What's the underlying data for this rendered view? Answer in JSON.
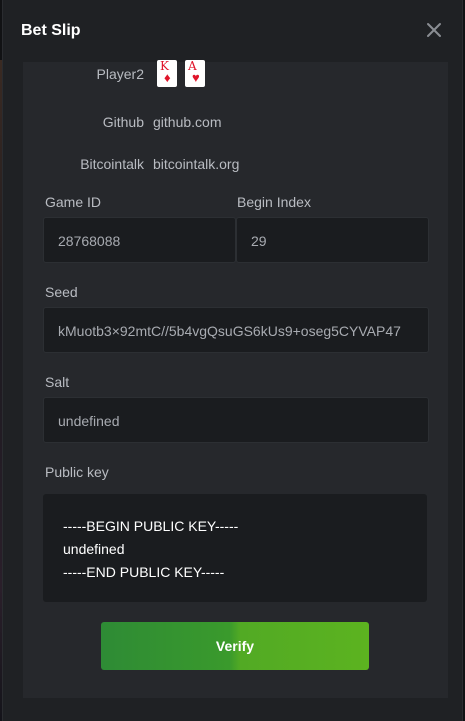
{
  "modal": {
    "title": "Bet Slip",
    "close_icon": "close-icon"
  },
  "info": {
    "player_label": "Player2",
    "cards": [
      {
        "rank": "K",
        "suit": "♦",
        "color": "#e0142a"
      },
      {
        "rank": "A",
        "suit": "♥",
        "color": "#e0142a"
      }
    ],
    "github_label": "Github",
    "github_value": "github.com",
    "bitcointalk_label": "Bitcointalk",
    "bitcointalk_value": "bitcointalk.org"
  },
  "fields": {
    "game_id_label": "Game ID",
    "game_id_value": "28768088",
    "begin_index_label": "Begin Index",
    "begin_index_value": "29",
    "seed_label": "Seed",
    "seed_value": "kMuotb3×92mtC//5b4vgQsuGS6kUs9+oseg5CYVAP47",
    "salt_label": "Salt",
    "salt_value": "undefined",
    "public_key_label": "Public key",
    "public_key_lines": [
      "-----BEGIN PUBLIC KEY-----",
      "undefined",
      "-----END PUBLIC KEY-----"
    ]
  },
  "actions": {
    "verify_label": "Verify"
  },
  "colors": {
    "accent_green": "#3a9a2c",
    "card_red": "#e0142a"
  }
}
